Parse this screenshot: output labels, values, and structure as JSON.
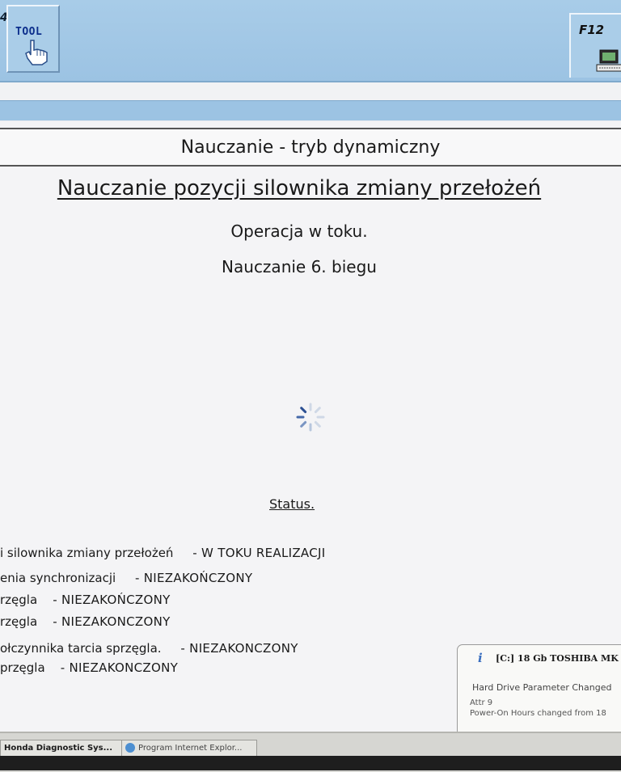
{
  "toolbar": {
    "page_number": "4",
    "tool_button_label": "TOOL",
    "f12_button_label": "F12",
    "tool_icon": "hand-pointer-icon",
    "f12_icon": "computer-icon"
  },
  "screen_title": "Nauczanie - tryb dynamiczny",
  "heading": "Nauczanie pozycji silownika zmiany przełożeń",
  "operation_status": "Operacja w toku.",
  "operation_detail": "Nauczanie 6. biegu",
  "status_heading": "Status.",
  "status_rows": [
    {
      "label": "i silownika zmiany przełożeń",
      "value": "- W TOKU REALIZACJI"
    },
    {
      "label": "enia synchronizacji",
      "value": "- NIEZAKOŃCZONY"
    },
    {
      "label": "rzęgla",
      "value": "- NIEZAKOŃCZONY"
    },
    {
      "label": "rzęgla",
      "value": "- NIEZAKONCZONY"
    },
    {
      "label": "ołczynnika tarcia sprzęgla.",
      "value": "- NIEZAKONCZONY"
    },
    {
      "label": "przęgla",
      "value": "- NIEZAKONCZONY"
    }
  ],
  "notification": {
    "title": "[C:] 18 Gb TOSHIBA MK",
    "line1": "Hard Drive Parameter Changed",
    "line2": "Attr 9",
    "line3": "Power-On Hours changed from 18"
  },
  "taskbar": {
    "app1": "Honda Diagnostic Sys...",
    "app2": "Program Internet Explor..."
  },
  "colors": {
    "toolbar_blue": "#9cc3e3",
    "panel_background": "#f4f4f6",
    "tool_label": "#0c2e8c",
    "info_icon": "#3a6fc0"
  }
}
